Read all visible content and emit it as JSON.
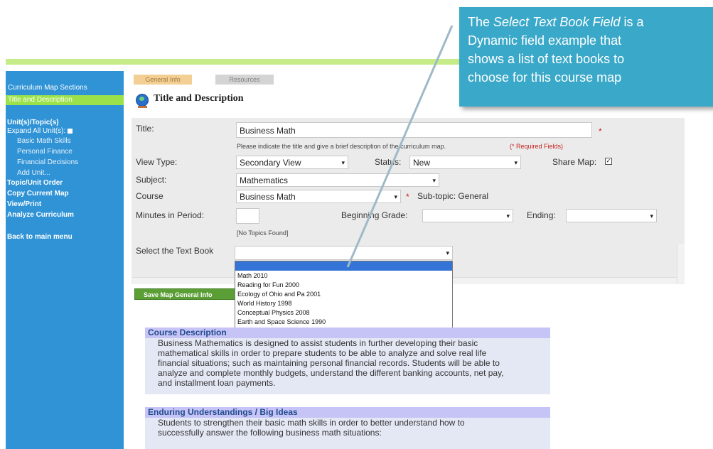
{
  "sidebar": {
    "sections_label": "Curriculum Map Sections",
    "title_desc": "Title and Description",
    "units_label": "Unit(s)/Topic(s)",
    "expand_label": "Expand All Unit(s):",
    "units": [
      "Basic Math Skills",
      "Personal Finance",
      "Financial Decisions",
      "Add Unit..."
    ],
    "links": [
      "Topic/Unit Order",
      "Copy Current Map",
      "View/Print",
      "Analyze Curriculum"
    ],
    "back": "Back to main menu"
  },
  "tabs": {
    "general": "General Info",
    "resources": "Resources"
  },
  "section_title": "Title and Description",
  "form": {
    "title_label": "Title:",
    "title_value": "Business Math",
    "title_hint": "Please indicate the title and give a brief description of the curriculum map.",
    "required_note": "(* Required Fields)",
    "required_star": "*",
    "view_type_label": "View Type:",
    "view_type_value": "Secondary View",
    "status_label": "Status:",
    "status_value": "New",
    "share_label": "Share Map:",
    "share_check": "✓",
    "subject_label": "Subject:",
    "subject_value": "Mathematics",
    "course_label": "Course",
    "course_value": "Business Math",
    "subtopic_label": "Sub-topic: General",
    "minutes_label": "Minutes in Period:",
    "minutes_value": "",
    "begin_grade_label": "Beginning Grade:",
    "ending_label": "Ending:",
    "no_topics": "[No Topics Found]",
    "textbook_label": "Select the Text Book"
  },
  "textbook_options": [
    "Math 2010",
    "Reading for Fun 2000",
    "Ecology of Ohio and Pa 2001",
    "World History 1998",
    "Conceptual Physics 2008",
    "Earth and Space Science 1990"
  ],
  "save_button": "Save Map General Info",
  "course_description": {
    "heading": "Course Description",
    "lines": [
      "Business Mathematics is designed to assist students in further developing their basic",
      "mathematical skills in order to prepare students to be able to analyze and solve real life",
      "financial situations; such as maintaining personal financial records.  Students will be able to",
      "analyze and complete monthly budgets, understand the different banking accounts, net pay,",
      "and installment loan payments."
    ]
  },
  "enduring": {
    "heading": "Enduring Understandings / Big Ideas",
    "lines": [
      "Students to strengthen their basic math skills in order to better understand how to",
      "successfully answer the following business math situations:"
    ]
  },
  "callout": {
    "prefix": "The ",
    "emph": "Select Text Book Field",
    "line1_suffix": " is a",
    "line2": "Dynamic field example that",
    "line3": "shows a list of text books to",
    "line4": "choose for this course map"
  },
  "colors": {
    "sidebar": "#2f93d6",
    "accent_green": "#9be24a",
    "callout": "#3aa8c8",
    "section_head": "#c6c4f6"
  }
}
